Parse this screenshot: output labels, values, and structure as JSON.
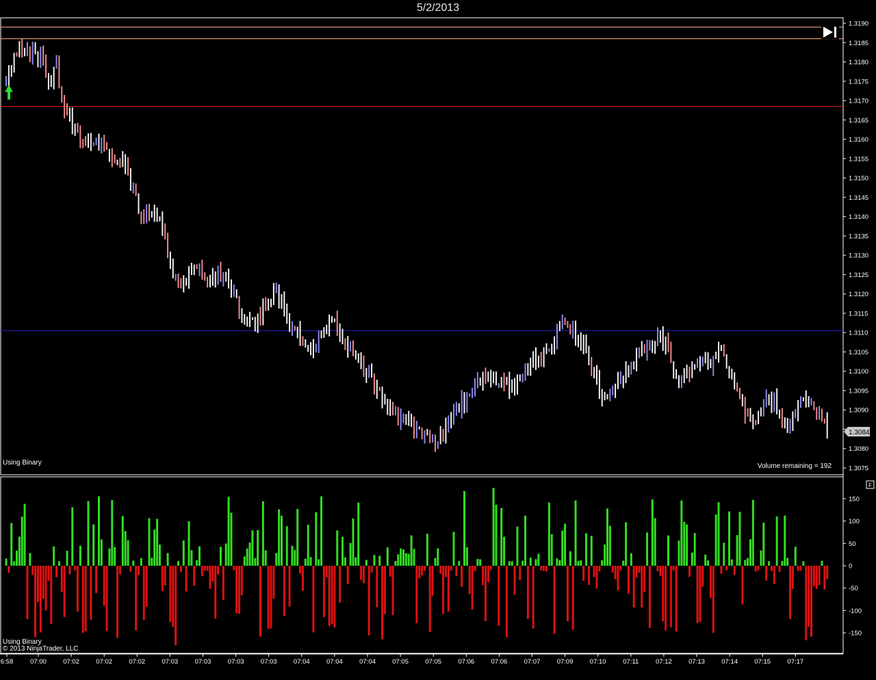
{
  "title": "5/2/2013",
  "colors": {
    "background": "#000000",
    "bar_up": "#8888ee",
    "bar_down": "#ee8888",
    "bar_neutral": "#f0f0f0",
    "hist_up": "#33dd22",
    "hist_down": "#dd1111",
    "line_red": "#e02020",
    "line_blue": "#2020cc",
    "line_peach": "#ffb48c",
    "arrow_up": "#33dd33"
  },
  "price_panel": {
    "indicator_label": "Using Binary",
    "volume_remaining": "Volume remaining = 192",
    "current_price_label": "1.3084",
    "ylim": [
      1.3073,
      1.3192
    ],
    "y_ticks": [
      "1.3190",
      "1.3185",
      "1.3180",
      "1.3175",
      "1.3170",
      "1.3165",
      "1.3160",
      "1.3155",
      "1.3150",
      "1.3145",
      "1.3140",
      "1.3135",
      "1.3130",
      "1.3125",
      "1.3120",
      "1.3115",
      "1.3110",
      "1.3105",
      "1.3100",
      "1.3095",
      "1.3090",
      "1.3085",
      "1.3080",
      "1.3075"
    ],
    "horizontal_lines": [
      {
        "price": 1.3189,
        "color": "#ffb48c"
      },
      {
        "price": 1.3186,
        "color": "#ffb48c"
      },
      {
        "price": 1.31685,
        "color": "#e02020"
      },
      {
        "price": 1.31105,
        "color": "#2020cc"
      }
    ]
  },
  "volume_panel": {
    "indicator_label": "Using Binary",
    "copyright": "© 2013 NinjaTrader, LLC",
    "ylim": [
      -180,
      190
    ],
    "y_ticks": [
      "150",
      "100",
      "50",
      "0",
      "-50",
      "-100",
      "-150"
    ],
    "legend_box": "F"
  },
  "x_axis": {
    "labels": [
      "6:58",
      "07:00",
      "07:02",
      "07:02",
      "07:02",
      "07:03",
      "07:03",
      "07:03",
      "07:03",
      "07:04",
      "07:04",
      "07:04",
      "07:05",
      "07:05",
      "07:06",
      "07:06",
      "07:07",
      "07:09",
      "07:10",
      "07:11",
      "07:12",
      "07:13",
      "07:14",
      "07:15",
      "07:17"
    ]
  },
  "chart_data": {
    "type": "bar",
    "title": "5/2/2013",
    "price_anchors": [
      [
        0,
        1.3177
      ],
      [
        2,
        1.318
      ],
      [
        4,
        1.3183
      ],
      [
        6,
        1.3184
      ],
      [
        10,
        1.3182
      ],
      [
        14,
        1.318
      ],
      [
        16,
        1.3176
      ],
      [
        19,
        1.3178
      ],
      [
        22,
        1.3168
      ],
      [
        26,
        1.3162
      ],
      [
        30,
        1.316
      ],
      [
        33,
        1.3158
      ],
      [
        36,
        1.3161
      ],
      [
        40,
        1.3155
      ],
      [
        44,
        1.3155
      ],
      [
        48,
        1.3147
      ],
      [
        51,
        1.314
      ],
      [
        54,
        1.3141
      ],
      [
        58,
        1.3138
      ],
      [
        62,
        1.3128
      ],
      [
        65,
        1.3123
      ],
      [
        68,
        1.3125
      ],
      [
        72,
        1.3127
      ],
      [
        76,
        1.3124
      ],
      [
        82,
        1.3125
      ],
      [
        86,
        1.312
      ],
      [
        90,
        1.3113
      ],
      [
        94,
        1.3113
      ],
      [
        98,
        1.3118
      ],
      [
        102,
        1.3121
      ],
      [
        106,
        1.3113
      ],
      [
        110,
        1.311
      ],
      [
        114,
        1.3104
      ],
      [
        117,
        1.3106
      ],
      [
        120,
        1.3111
      ],
      [
        124,
        1.3112
      ],
      [
        128,
        1.3108
      ],
      [
        132,
        1.3104
      ],
      [
        136,
        1.31
      ],
      [
        140,
        1.3095
      ],
      [
        144,
        1.309
      ],
      [
        150,
        1.3088
      ],
      [
        156,
        1.3084
      ],
      [
        160,
        1.3083
      ],
      [
        162,
        1.3081
      ],
      [
        166,
        1.3085
      ],
      [
        170,
        1.309
      ],
      [
        174,
        1.3094
      ],
      [
        178,
        1.3097
      ],
      [
        182,
        1.3099
      ],
      [
        186,
        1.3098
      ],
      [
        190,
        1.3096
      ],
      [
        194,
        1.3099
      ],
      [
        198,
        1.3102
      ],
      [
        202,
        1.3104
      ],
      [
        206,
        1.3107
      ],
      [
        210,
        1.3114
      ],
      [
        214,
        1.311
      ],
      [
        218,
        1.3106
      ],
      [
        222,
        1.3099
      ],
      [
        226,
        1.3093
      ],
      [
        230,
        1.3096
      ],
      [
        234,
        1.31
      ],
      [
        238,
        1.3104
      ],
      [
        242,
        1.3107
      ],
      [
        246,
        1.3109
      ],
      [
        250,
        1.3106
      ],
      [
        254,
        1.3097
      ],
      [
        258,
        1.3101
      ],
      [
        262,
        1.3104
      ],
      [
        266,
        1.3102
      ],
      [
        270,
        1.3105
      ],
      [
        274,
        1.3099
      ],
      [
        278,
        1.3091
      ],
      [
        282,
        1.3087
      ],
      [
        286,
        1.3091
      ],
      [
        290,
        1.3093
      ],
      [
        294,
        1.3085
      ],
      [
        298,
        1.3089
      ],
      [
        302,
        1.3094
      ],
      [
        306,
        1.309
      ],
      [
        310,
        1.3085
      ]
    ],
    "volume_seed": 1301
  }
}
